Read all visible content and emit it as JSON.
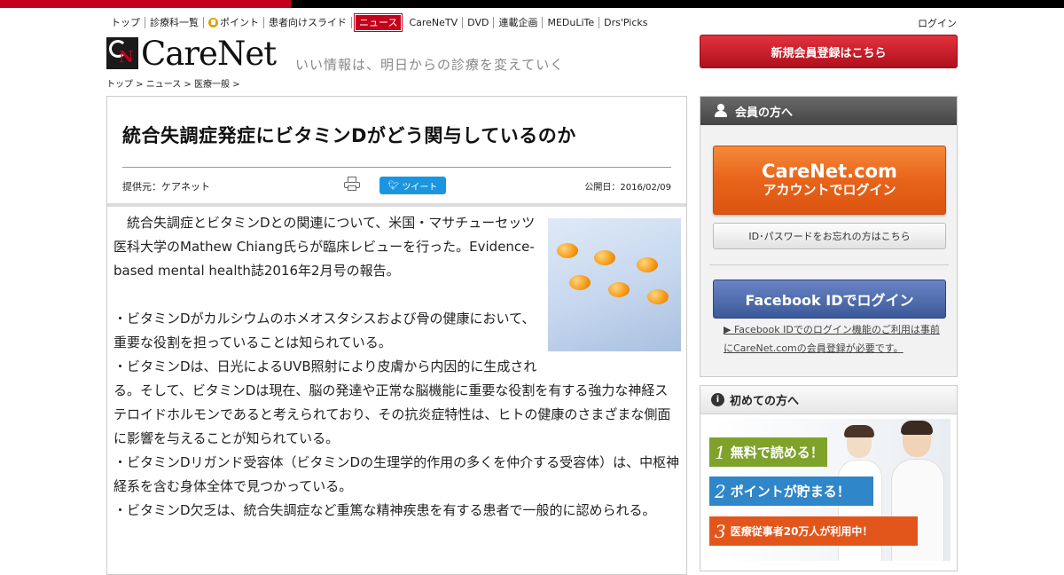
{
  "nav": {
    "items": [
      "トップ",
      "診療科一覧",
      "ポイント",
      "患者向けスライド",
      "ニュース",
      "CareNeTV",
      "DVD",
      "連載企画",
      "MEDuLiTe",
      "Drs'Picks"
    ],
    "login": "ログイン"
  },
  "header": {
    "logo_text": "CareNet",
    "tagline": "いい情報は、明日からの診療を変えていく",
    "register_button": "新規会員登録はこちら"
  },
  "breadcrumb": "トップ > ニュース > 医療一般 >",
  "article": {
    "title": "統合失調症発症にビタミンDがどう関与しているのか",
    "provider": "提供元：ケアネット",
    "tweet": "ツイート",
    "date": "公開日：2016/02/09",
    "paragraphs": [
      "　統合失調症とビタミンDとの関連について、米国・マサチューセッツ医科大学のMathew Chiang氏らが臨床レビューを行った。Evidence-based mental health誌2016年2月号の報告。",
      "",
      "・ビタミンDがカルシウムのホメオスタシスおよび骨の健康において、重要な役割を担っていることは知られている。",
      "・ビタミンDは、日光によるUVB照射により皮膚から内因的に生成される。そして、ビタミンDは現在、脳の発達や正常な脳機能に重要な役割を有する強力な神経ステロイドホルモンであると考えられており、その抗炎症特性は、ヒトの健康のさまざまな側面に影響を与えることが知られている。",
      "・ビタミンDリガンド受容体（ビタミンDの生理学的作用の多くを仲介する受容体）は、中枢神経系を含む身体全体で見つかっている。",
      "・ビタミンD欠乏は、統合失調症など重篤な精神疾患を有する患者で一般的に認められる。"
    ]
  },
  "members": {
    "heading": "会員の方へ",
    "carenet_login_line1": "CareNet.com",
    "carenet_login_line2": "アカウントでログイン",
    "forgot": "ID･パスワードをお忘れの方はこちら",
    "facebook_login": "Facebook IDでログイン",
    "facebook_note": "▶ Facebook IDでのログイン機能のご利用は事前にCareNet.comの会員登録が必要です。"
  },
  "first_time": {
    "heading": "初めての方へ",
    "ribbons": [
      {
        "num": "1",
        "text": "無料で読める！"
      },
      {
        "num": "2",
        "text": "ポイントが貯まる！"
      },
      {
        "num": "3",
        "text": "医療従事者20万人が利用中！"
      }
    ]
  },
  "colors": {
    "brand_red": "#c4001b",
    "orange": "#e8641a",
    "facebook": "#3b5998",
    "twitter": "#1b95e0"
  }
}
